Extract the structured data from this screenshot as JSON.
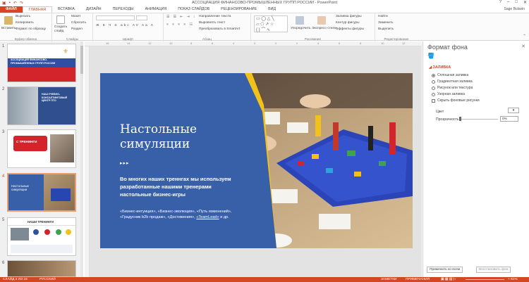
{
  "app": {
    "window_title": "АССОЦИАЦИЯ ФИНАНСОВО-ПРОМЫШЛЕННЫХ ГРУПП РОССИИ - PowerPoint",
    "user": "Sage Bulavin"
  },
  "tabs": [
    "ФАЙЛ",
    "ГЛАВНАЯ",
    "ВСТАВКА",
    "ДИЗАЙН",
    "ПЕРЕХОДЫ",
    "АНИМАЦИЯ",
    "ПОКАЗ СЛАЙДОВ",
    "РЕЦЕНЗИРОВАНИЕ",
    "ВИД"
  ],
  "ribbon": {
    "clipboard": {
      "label": "Буфер обмена",
      "paste": "Вставить",
      "cut": "Вырезать",
      "copy": "Копировать",
      "format": "Формат по образцу"
    },
    "slides": {
      "label": "Слайды",
      "new": "Создать слайд",
      "layout": "Макет",
      "reset": "Сбросить",
      "section": "Раздел"
    },
    "font": {
      "label": "Шрифт",
      "buttons": "Ж К Ч S abc AV Aa A"
    },
    "paragraph": {
      "label": "Абзац",
      "direction": "Направление текста",
      "align": "Выровнять текст",
      "smartart": "Преобразовать в SmartArt"
    },
    "drawing": {
      "label": "Рисование",
      "arrange": "Упорядочить",
      "styles": "Экспресс-стили",
      "fill": "Заливка фигуры",
      "outline": "Контур фигуры",
      "effects": "Эффекты фигуры"
    },
    "editing": {
      "label": "Редактирование",
      "find": "Найти",
      "replace": "Заменить",
      "select": "Выделить"
    }
  },
  "slide_numbers": [
    "1",
    "2",
    "3",
    "4",
    "5",
    "6"
  ],
  "thumbs": {
    "t1": "АССОЦИАЦИЯ ФИНАНСОВО-ПРОМЫШЛЕННЫХ ГРУПП РОССИИ",
    "t2": "НАШ УЧЕБНО-КОНСАЛТИНГОВЫЙ ЦЕНТР ПТО",
    "t3": "С ТРЕНИНГИ",
    "t4": "Настольные симуляции",
    "t5": "НАШИ ТРЕНИНГИ"
  },
  "slide": {
    "title_line1": "Настольные",
    "title_line2": "симуляции",
    "body": "Во многих наших треннгах мы используем разработанные нашими тренерами настольные бизнес-игры",
    "list_1": "«Бизнес-интуиция», «Бизнес-эволюция», «Путь изменений», «Градусник b2b продаж», «Достижения»,",
    "list_link": "«TeamLead»",
    "list_end": " и др."
  },
  "format_pane": {
    "title": "Формат фона",
    "section": "ЗАЛИВКА",
    "options": [
      "Сплошная заливка",
      "Градиентная заливка",
      "Рисунок или текстура",
      "Узорная заливка"
    ],
    "hide_graphics": "Скрыть фоновые рисунки",
    "color_label": "Цвет",
    "transparency_label": "Прозрачность",
    "transparency_value": "0%",
    "apply_all": "Применить ко всем",
    "restore": "Восстановить фон"
  },
  "status": {
    "slide_info": "СЛАЙД 4 ИЗ 16",
    "language": "РУССКИЙ",
    "notes": "ЗАМЕТКИ",
    "comments": "ПРИМЕЧАНИЯ",
    "zoom": "+ 61%"
  },
  "colors": {
    "accent": "#d24726",
    "slide_blue": "#3760a9",
    "slide_yellow": "#f2c21b"
  }
}
